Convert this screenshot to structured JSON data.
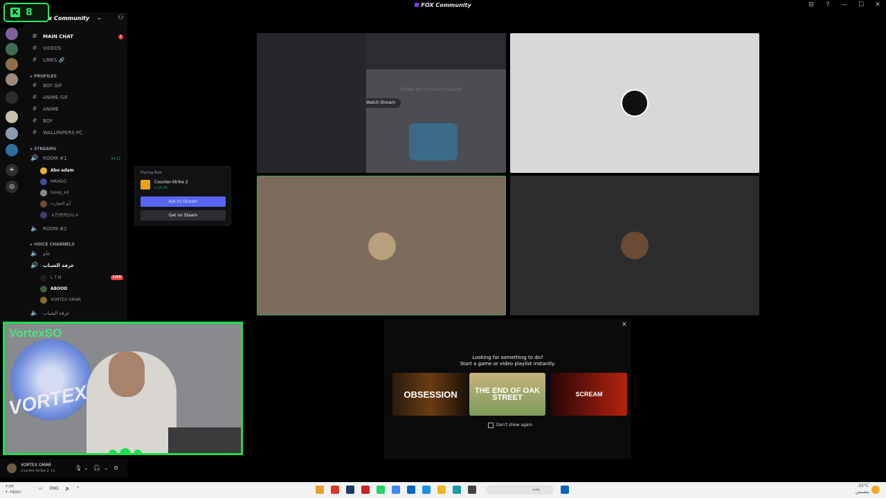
{
  "window": {
    "title": "FOX Community",
    "controls": [
      "⊟",
      "?",
      "—",
      "☐",
      "✕"
    ]
  },
  "server": {
    "name": "x Community",
    "chevron": "⌄"
  },
  "channels": {
    "text_top": [
      {
        "name": "MAIN CHAT",
        "unread": "1"
      },
      {
        "name": "VIDEOS"
      },
      {
        "name": "LINKS 🔗"
      }
    ],
    "profiles_category": "PROFILES",
    "profiles": [
      "BOY GIF",
      "ANIME GIF",
      "ANIME",
      "BOY",
      "WALLPAPERS PC"
    ],
    "streams_category": "STREAMS",
    "room1": {
      "name": "ROOM #1",
      "timer": "44:11"
    },
    "room1_users": [
      "Abo adam",
      "MAHDG",
      "tareq_xd",
      "أبو الحوارث",
      "メ乃丹尺Oルメ"
    ],
    "room2": {
      "name": "ROOM #2"
    },
    "voice_category": "VOICE CHANNELS",
    "voice": [
      {
        "name": "عام"
      },
      {
        "name": "عزفة الشباب"
      }
    ],
    "voice_users": [
      {
        "name": "L T N",
        "live": "LIVE"
      },
      {
        "name": "ABOOD"
      },
      {
        "name": "VORTEX OMAR"
      }
    ],
    "voice_tail": "غرفة الشباب"
  },
  "popover": {
    "header": "Playing Now",
    "game": "Counter-Strike 2",
    "time": "1:25:35",
    "ask_label": "Ask to Stream",
    "steam_label": "Get on Steam"
  },
  "stage": {
    "watch_label": "Watch Stream",
    "ghost_text": "Please do not close this page"
  },
  "suggest": {
    "line1": "Looking for something to do?",
    "line2": "Start a game or video playlist instantly.",
    "cards": [
      "OBSESSION",
      "THE END OF OAK STREET",
      "SCREAM"
    ],
    "dont_show": "Don't show again"
  },
  "webcam": {
    "name": "VortexSO",
    "logo_text": "VORTEX ZONE"
  },
  "obs": {
    "letter": "K",
    "count": "8"
  },
  "user": {
    "name": "VORTEX OMAR",
    "status": "Counter-Strike 2 +1"
  },
  "taskbar": {
    "time": "٢:٣٣",
    "date": "٢٠٢٥/٨/١",
    "lang": "ENG",
    "weather": "32°C",
    "weather_sub": "مشمس",
    "search_placeholder": "بحث"
  },
  "colors": {
    "accent_green": "#18e04d",
    "blurple": "#5865f2",
    "live_red": "#f23f43"
  }
}
